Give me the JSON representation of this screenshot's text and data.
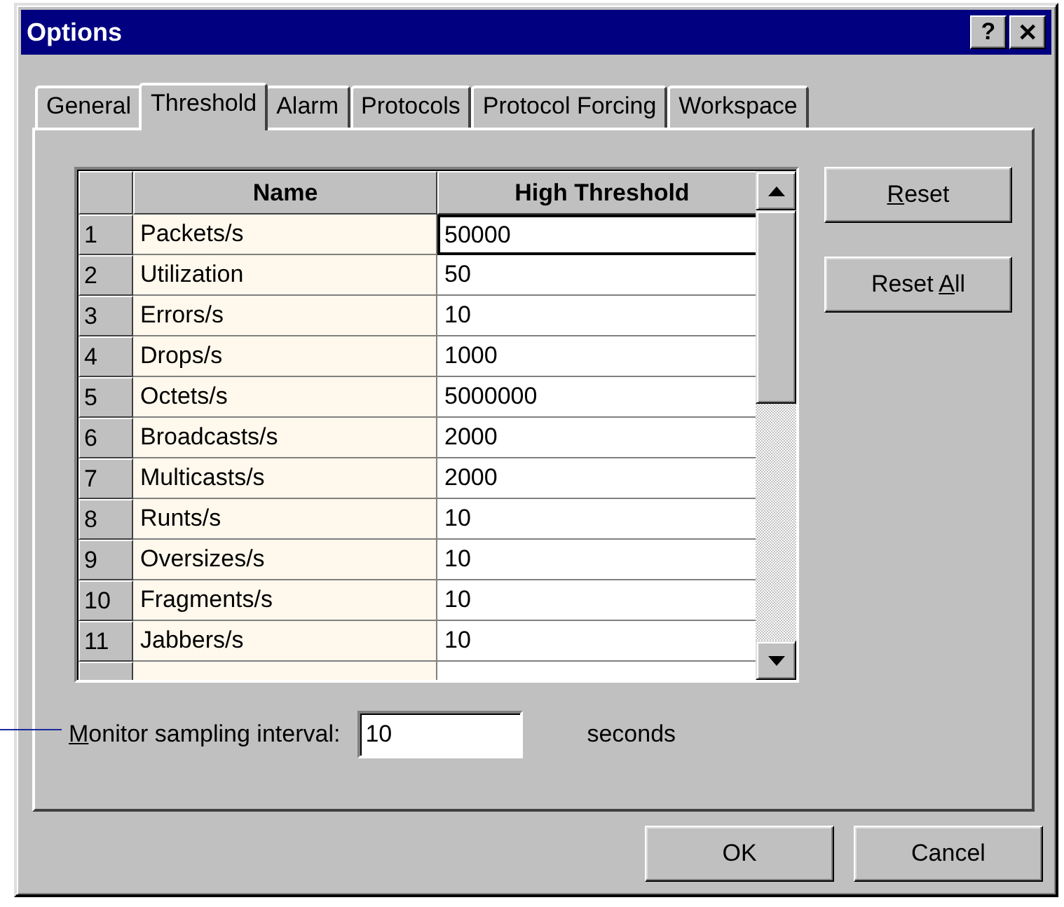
{
  "window": {
    "title": "Options",
    "title_buttons": [
      "?",
      "✕"
    ]
  },
  "tabs": [
    {
      "label": "General",
      "selected": false
    },
    {
      "label": "Threshold",
      "selected": true
    },
    {
      "label": "Alarm",
      "selected": false
    },
    {
      "label": "Protocols",
      "selected": false
    },
    {
      "label": "Protocol Forcing",
      "selected": false
    },
    {
      "label": "Workspace",
      "selected": false
    }
  ],
  "table": {
    "columns": [
      "Name",
      "High Threshold"
    ],
    "rows": [
      {
        "index": "1",
        "name": "Packets/s",
        "value": "50000",
        "selected": true
      },
      {
        "index": "2",
        "name": "Utilization",
        "value": "50",
        "selected": false
      },
      {
        "index": "3",
        "name": "Errors/s",
        "value": "10",
        "selected": false
      },
      {
        "index": "4",
        "name": "Drops/s",
        "value": "1000",
        "selected": false
      },
      {
        "index": "5",
        "name": "Octets/s",
        "value": "5000000",
        "selected": false
      },
      {
        "index": "6",
        "name": "Broadcasts/s",
        "value": "2000",
        "selected": false
      },
      {
        "index": "7",
        "name": "Multicasts/s",
        "value": "2000",
        "selected": false
      },
      {
        "index": "8",
        "name": "Runts/s",
        "value": "10",
        "selected": false
      },
      {
        "index": "9",
        "name": "Oversizes/s",
        "value": "10",
        "selected": false
      },
      {
        "index": "10",
        "name": "Fragments/s",
        "value": "10",
        "selected": false
      },
      {
        "index": "11",
        "name": "Jabbers/s",
        "value": "10",
        "selected": false
      }
    ]
  },
  "side_buttons": [
    {
      "label_parts": [
        {
          "text": "R",
          "underlined": true
        },
        {
          "text": "eset",
          "underlined": false
        }
      ]
    },
    {
      "label_parts": [
        {
          "text": "Reset ",
          "underlined": false
        },
        {
          "text": "A",
          "underlined": true
        },
        {
          "text": "ll",
          "underlined": false
        }
      ]
    }
  ],
  "sampling": {
    "label_parts": [
      {
        "text": "M",
        "underlined": true
      },
      {
        "text": "onitor sampling interval:",
        "underlined": false
      }
    ],
    "value": "10",
    "unit": "seconds"
  },
  "buttons": [
    {
      "label": "OK"
    },
    {
      "label": "Cancel"
    }
  ]
}
